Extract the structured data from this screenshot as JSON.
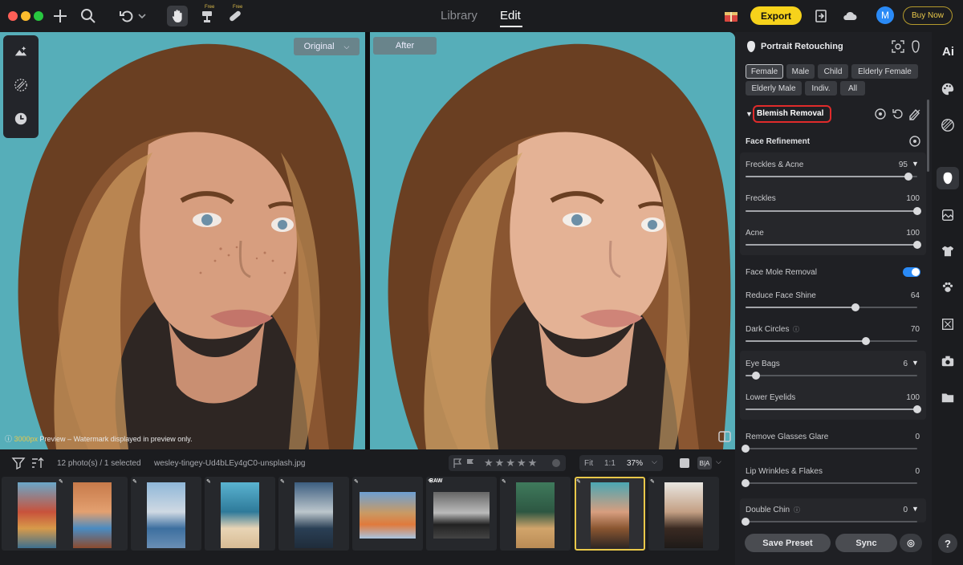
{
  "window": {
    "traffic_lights": [
      "#fe5f57",
      "#febc2e",
      "#28c840"
    ]
  },
  "toolbar": {
    "free_label_1": "Free",
    "free_label_2": "Free",
    "tabs": [
      {
        "label": "Library"
      },
      {
        "label": "Edit"
      }
    ],
    "active_tab": "Edit",
    "export_label": "Export",
    "avatar_initial": "M",
    "buy_now_label": "Buy Now"
  },
  "viewer": {
    "original_label": "Original",
    "after_label": "After",
    "watermark_size": "3000px",
    "watermark_text": " Preview – Watermark displayed in preview only."
  },
  "filmstrip": {
    "count_text": "12 photo(s) / 1 selected",
    "filename": "wesley-tingey-Ud4bLEy4gC0-unsplash.jpg",
    "fit_label": "Fit",
    "one_to_one_label": "1:1",
    "zoom_label": "37%",
    "ba_label": "B|A",
    "raw_badge": "RAW",
    "selected_index": 7,
    "stars": 5
  },
  "panel": {
    "title": "Portrait Retouching",
    "gender_tags": [
      "Female",
      "Male",
      "Child",
      "Elderly Female",
      "Elderly Male",
      "Indiv.",
      "All"
    ],
    "selected_tag": "Female",
    "section_title": "Blemish Removal",
    "face_refinement_label": "Face Refinement",
    "sliders": [
      {
        "label": "Freckles & Acne",
        "value": 95
      },
      {
        "label": "Freckles",
        "value": 100
      },
      {
        "label": "Acne",
        "value": 100
      },
      {
        "label": "Reduce Face Shine",
        "value": 64
      },
      {
        "label": "Dark Circles",
        "value": 70
      },
      {
        "label": "Eye Bags",
        "value": 6
      },
      {
        "label": "Lower Eyelids",
        "value": 100
      },
      {
        "label": "Remove Glasses Glare",
        "value": 0
      },
      {
        "label": "Lip Wrinkles & Flakes",
        "value": 0
      },
      {
        "label": "Double Chin",
        "value": 0
      }
    ],
    "mole_label": "Face Mole Removal",
    "mole_enabled": true,
    "save_preset_label": "Save Preset",
    "sync_label": "Sync"
  },
  "right_strip": {
    "ai_label": "Ai",
    "help_label": "?"
  },
  "colors": {
    "accent": "#f6d21b",
    "toggle": "#2a8af6",
    "highlight": "#e02b2b",
    "selected_thumb": "#e9c84a"
  }
}
